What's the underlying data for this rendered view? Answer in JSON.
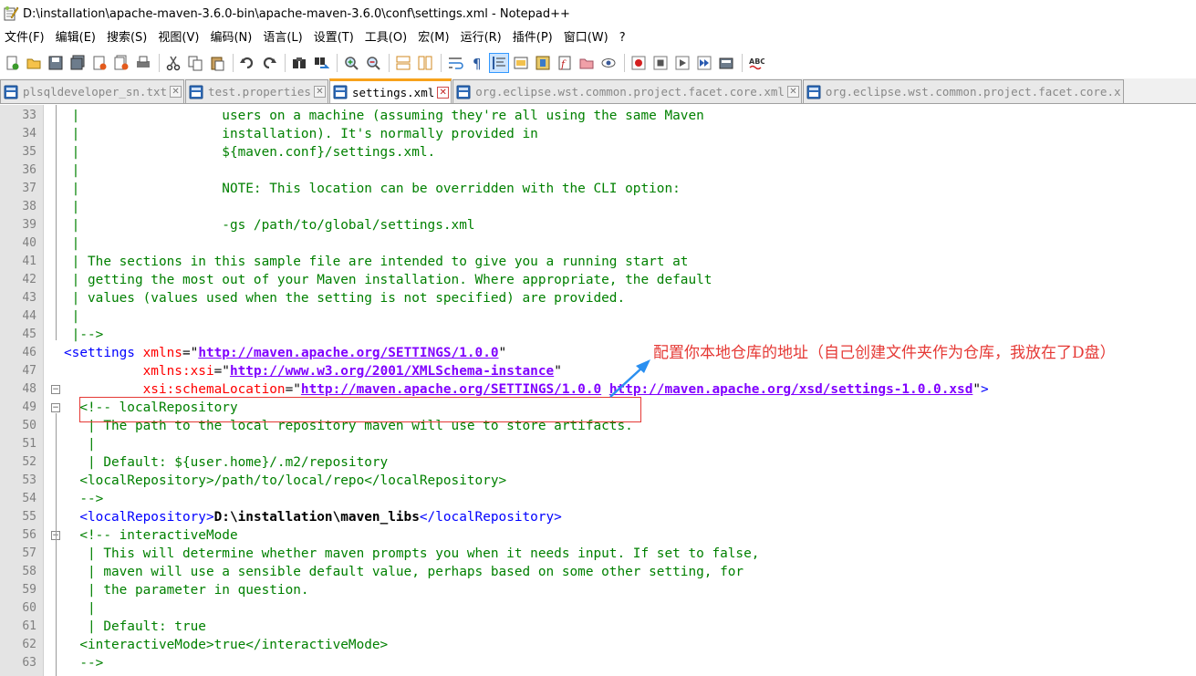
{
  "window": {
    "title": "D:\\installation\\apache-maven-3.6.0-bin\\apache-maven-3.6.0\\conf\\settings.xml - Notepad++"
  },
  "menu": [
    "文件(F)",
    "编辑(E)",
    "搜索(S)",
    "视图(V)",
    "编码(N)",
    "语言(L)",
    "设置(T)",
    "工具(O)",
    "宏(M)",
    "运行(R)",
    "插件(P)",
    "窗口(W)",
    "?"
  ],
  "toolbar": {
    "icons": [
      "new-file-icon",
      "open-file-icon",
      "save-icon",
      "save-all-icon",
      "close-icon",
      "close-all-icon",
      "print-icon",
      "cut-icon",
      "copy-icon",
      "paste-icon",
      "undo-icon",
      "redo-icon",
      "find-icon",
      "replace-icon",
      "zoom-in-icon",
      "zoom-out-icon",
      "sync-vertical-icon",
      "sync-horizontal-icon",
      "word-wrap-icon",
      "show-all-chars-icon",
      "indent-guide-icon",
      "udl-icon",
      "doc-map-icon",
      "function-list-icon",
      "folder-workspace-icon",
      "monitoring-icon",
      "record-macro-icon",
      "stop-macro-icon",
      "play-macro-icon",
      "run-macro-multiple-icon",
      "save-macro-icon",
      "spell-check-icon"
    ]
  },
  "tabs": [
    {
      "label": "plsqldeveloper_sn.txt",
      "active": false
    },
    {
      "label": "test.properties",
      "active": false
    },
    {
      "label": "settings.xml",
      "active": true
    },
    {
      "label": "org.eclipse.wst.common.project.facet.core.xml",
      "active": false
    },
    {
      "label": "org.eclipse.wst.common.project.facet.core.x",
      "active": false
    }
  ],
  "editor": {
    "lines": [
      {
        "n": "33",
        "segs": [
          {
            "t": " |                  users on a machine (assuming they're all using the same Maven",
            "c": "cm"
          }
        ]
      },
      {
        "n": "34",
        "segs": [
          {
            "t": " |                  installation). It's normally provided in",
            "c": "cm"
          }
        ]
      },
      {
        "n": "35",
        "segs": [
          {
            "t": " |                  ${maven.conf}/settings.xml.",
            "c": "cm"
          }
        ]
      },
      {
        "n": "36",
        "segs": [
          {
            "t": " |",
            "c": "cm"
          }
        ]
      },
      {
        "n": "37",
        "segs": [
          {
            "t": " |                  NOTE: This location can be overridden with the CLI option:",
            "c": "cm"
          }
        ]
      },
      {
        "n": "38",
        "segs": [
          {
            "t": " |",
            "c": "cm"
          }
        ]
      },
      {
        "n": "39",
        "segs": [
          {
            "t": " |                  -gs /path/to/global/settings.xml",
            "c": "cm"
          }
        ]
      },
      {
        "n": "40",
        "segs": [
          {
            "t": " |",
            "c": "cm"
          }
        ]
      },
      {
        "n": "41",
        "segs": [
          {
            "t": " | The sections in this sample file are intended to give you a running start at",
            "c": "cm"
          }
        ]
      },
      {
        "n": "42",
        "segs": [
          {
            "t": " | getting the most out of your Maven installation. Where appropriate, the default",
            "c": "cm"
          }
        ]
      },
      {
        "n": "43",
        "segs": [
          {
            "t": " | values (values used when the setting is not specified) are provided.",
            "c": "cm"
          }
        ]
      },
      {
        "n": "44",
        "segs": [
          {
            "t": " |",
            "c": "cm"
          }
        ]
      },
      {
        "n": "45",
        "segs": [
          {
            "t": " |-->",
            "c": "cm"
          }
        ]
      },
      {
        "n": "46",
        "segs": [
          {
            "t": "<settings ",
            "c": "tag"
          },
          {
            "t": "xmlns",
            "c": "attr"
          },
          {
            "t": "=",
            "c": "eq"
          },
          {
            "t": "\"",
            "c": "eq"
          },
          {
            "t": "http://maven.apache.org/SETTINGS/1.0.0",
            "c": "val"
          },
          {
            "t": "\"",
            "c": "eq"
          }
        ]
      },
      {
        "n": "47",
        "segs": [
          {
            "t": "          ",
            "c": "eq"
          },
          {
            "t": "xmlns:xsi",
            "c": "attr"
          },
          {
            "t": "=\"",
            "c": "eq"
          },
          {
            "t": "http://www.w3.org/2001/XMLSchema-instance",
            "c": "val"
          },
          {
            "t": "\"",
            "c": "eq"
          }
        ]
      },
      {
        "n": "48",
        "segs": [
          {
            "t": "          ",
            "c": "eq"
          },
          {
            "t": "xsi:schemaLocation",
            "c": "attr"
          },
          {
            "t": "=\"",
            "c": "eq"
          },
          {
            "t": "http://maven.apache.org/SETTINGS/1.0.0",
            "c": "val"
          },
          {
            "t": " ",
            "c": "eq"
          },
          {
            "t": "http://maven.apache.org/xsd/settings-1.0.0.xsd",
            "c": "val"
          },
          {
            "t": "\"",
            "c": "eq"
          },
          {
            "t": ">",
            "c": "tag"
          }
        ]
      },
      {
        "n": "49",
        "segs": [
          {
            "t": "  <!-- localRepository",
            "c": "cm"
          }
        ]
      },
      {
        "n": "50",
        "segs": [
          {
            "t": "   | The path to the local repository maven will use to store artifacts.",
            "c": "cm"
          }
        ]
      },
      {
        "n": "51",
        "segs": [
          {
            "t": "   |",
            "c": "cm"
          }
        ]
      },
      {
        "n": "52",
        "segs": [
          {
            "t": "   | Default: ${user.home}/.m2/repository",
            "c": "cm"
          }
        ]
      },
      {
        "n": "53",
        "segs": [
          {
            "t": "  <localRepository>/path/to/local/repo</localRepository>",
            "c": "cm"
          }
        ]
      },
      {
        "n": "54",
        "segs": [
          {
            "t": "  -->",
            "c": "cm"
          }
        ]
      },
      {
        "n": "55",
        "segs": [
          {
            "t": "  ",
            "c": "eq"
          },
          {
            "t": "<localRepository>",
            "c": "tag"
          },
          {
            "t": "D:\\installation\\maven_libs",
            "c": "txt"
          },
          {
            "t": "</localRepository>",
            "c": "tag"
          }
        ]
      },
      {
        "n": "56",
        "segs": [
          {
            "t": "  <!-- interactiveMode",
            "c": "cm"
          }
        ]
      },
      {
        "n": "57",
        "segs": [
          {
            "t": "   | This will determine whether maven prompts you when it needs input. If set to false,",
            "c": "cm"
          }
        ]
      },
      {
        "n": "58",
        "segs": [
          {
            "t": "   | maven will use a sensible default value, perhaps based on some other setting, for",
            "c": "cm"
          }
        ]
      },
      {
        "n": "59",
        "segs": [
          {
            "t": "   | the parameter in question.",
            "c": "cm"
          }
        ]
      },
      {
        "n": "60",
        "segs": [
          {
            "t": "   |",
            "c": "cm"
          }
        ]
      },
      {
        "n": "61",
        "segs": [
          {
            "t": "   | Default: true",
            "c": "cm"
          }
        ]
      },
      {
        "n": "62",
        "segs": [
          {
            "t": "  <interactiveMode>true</interactiveMode>",
            "c": "cm"
          }
        ]
      },
      {
        "n": "63",
        "segs": [
          {
            "t": "  -->",
            "c": "cm"
          }
        ]
      }
    ]
  },
  "annotation": {
    "text": "配置你本地仓库的地址（自己创建文件夹作为仓库，我放在了D盘）",
    "color": "#e53935"
  },
  "colors": {
    "tag": "#0000ff",
    "attr": "#ff0000",
    "value": "#8000ff",
    "comment": "#008000",
    "active_tab_accent": "#f7a21b"
  }
}
